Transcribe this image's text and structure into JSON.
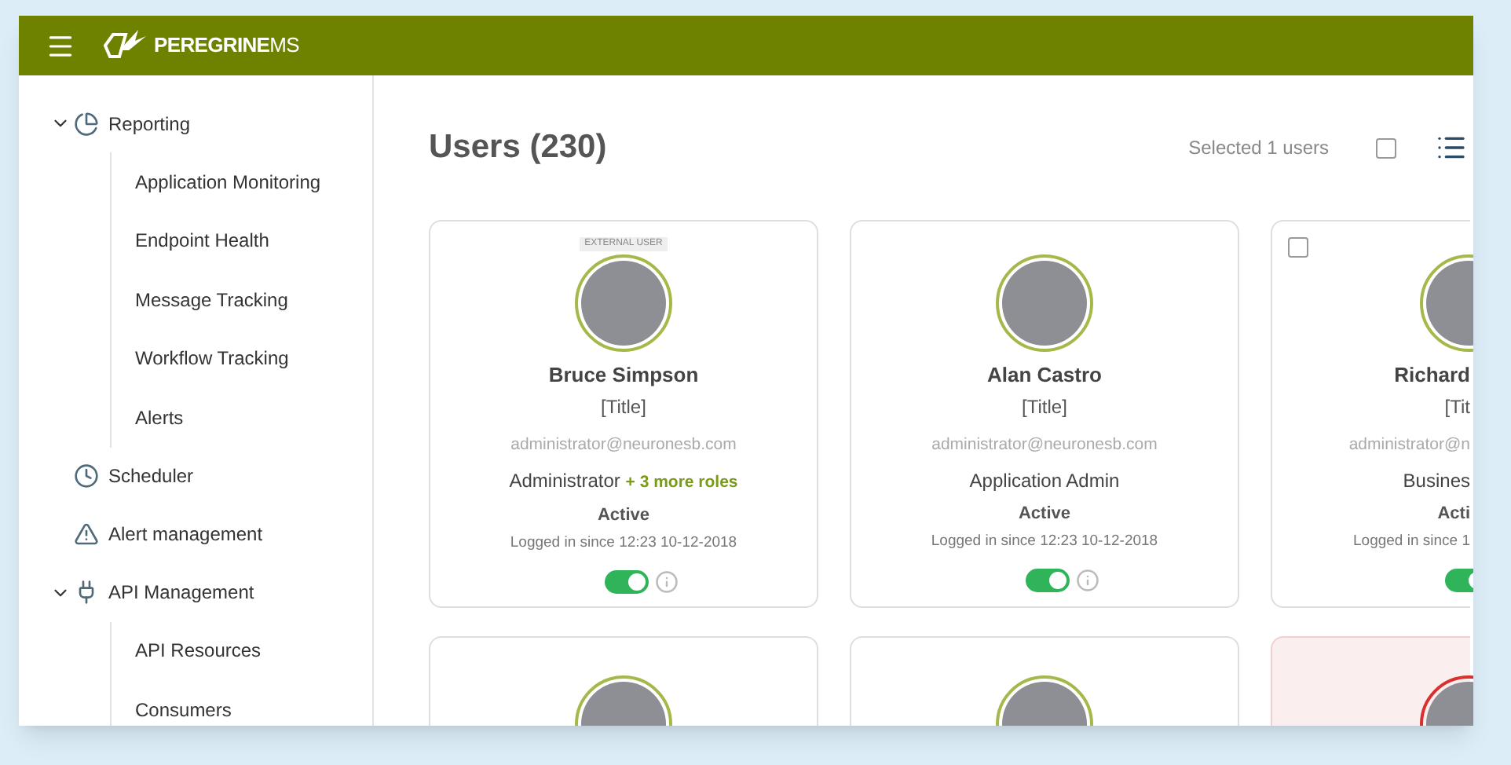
{
  "app": {
    "logo_text": "PEREGRINE",
    "logo_suffix": "MS"
  },
  "sidebar": {
    "items": [
      {
        "label": "Reporting",
        "expanded": true,
        "children": [
          {
            "label": "Application Monitoring"
          },
          {
            "label": "Endpoint Health"
          },
          {
            "label": "Message Tracking"
          },
          {
            "label": "Workflow Tracking"
          },
          {
            "label": "Alerts"
          }
        ]
      },
      {
        "label": "Scheduler"
      },
      {
        "label": "Alert management"
      },
      {
        "label": "API Management",
        "expanded": true,
        "children": [
          {
            "label": "API Resources"
          },
          {
            "label": "Consumers"
          }
        ]
      }
    ]
  },
  "header": {
    "title": "Users (230)",
    "selection": "Selected 1 users",
    "select_all_checked": false
  },
  "cards": [
    {
      "badge": "EXTERNAL USER",
      "name": "Bruce Simpson",
      "title": "[Title]",
      "email": "administrator@neuronesb.com",
      "role": "Administrator",
      "extra_roles": "+ 3 more roles",
      "status": "Active",
      "login": "Logged in since 12:23 10-12-2018",
      "on": true,
      "clipped": false
    },
    {
      "name": "Alan Castro",
      "title": "[Title]",
      "email": "administrator@neuronesb.com",
      "role": "Application Admin",
      "status": "Active",
      "login": "Logged in since 12:23 10-12-2018",
      "on": true,
      "clipped": false
    },
    {
      "name": "Richard",
      "title": "[Tit",
      "email": "administrator@n",
      "role": "Busines",
      "status": "Acti",
      "login": "Logged in since 1",
      "on": true,
      "clipped": true,
      "checked": false
    }
  ],
  "cards_row2": [
    {
      "flagged": false,
      "clipped": false
    },
    {
      "flagged": false,
      "clipped": false
    },
    {
      "flagged": true,
      "clipped": true
    }
  ]
}
